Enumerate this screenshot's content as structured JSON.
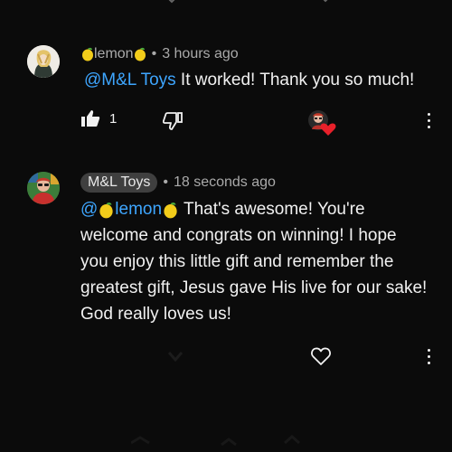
{
  "comments": [
    {
      "author": "lemon",
      "time": "3 hours ago",
      "mention": "@M&L Toys",
      "text": " It worked! Thank you so much!",
      "like_count": "1"
    },
    {
      "author": "M&L Toys",
      "time": "18 seconds ago",
      "mention_prefix": "@",
      "mention_name": "lemon",
      "text": "  That's awesome! You're welcome and congrats on winning! I hope you enjoy this little gift and remember the greatest gift, Jesus gave His live for our sake! God really loves us!"
    }
  ],
  "separator": "•",
  "colors": {
    "background": "#0b0b0b",
    "mention": "#3ea6ff",
    "heart": "#e8202a",
    "chip": "#3f3f3f"
  },
  "icons": [
    "like-icon",
    "dislike-icon",
    "heart-icon",
    "more-options-icon",
    "lemon-emoji"
  ]
}
